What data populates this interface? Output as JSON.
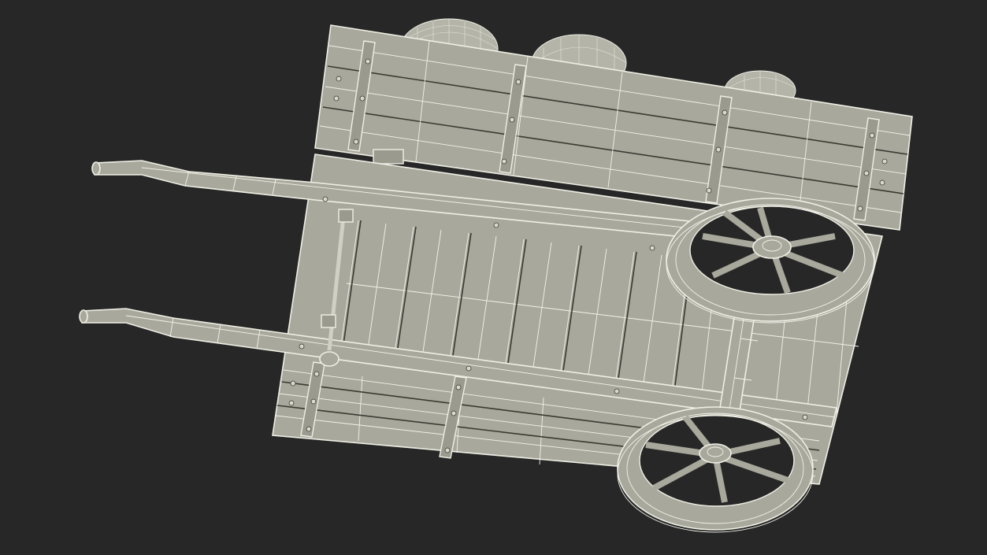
{
  "scene": {
    "subject": "",
    "background_color": "#272727",
    "mesh_fill_color": "#a8a89c",
    "wire_color": "#f2f2ea",
    "render_style": "wireframe-on-shaded"
  }
}
